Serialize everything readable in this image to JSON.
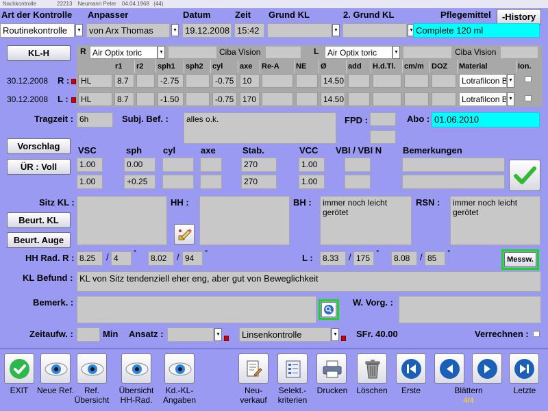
{
  "titlebar": {
    "app": "Nachkontrolle",
    "number": "22213",
    "customer": "Neumann Peter",
    "birthdate": "04.04.1968",
    "age": "(44)"
  },
  "header": {
    "art_label": "Art der Kontrolle",
    "anpasser_label": "Anpasser",
    "datum_label": "Datum",
    "zeit_label": "Zeit",
    "grundkl_label": "Grund KL",
    "grundkl2_label": "2. Grund KL",
    "pflege_label": "Pflegemittel",
    "history_button": "-History",
    "art_value": "Routinekontrolle",
    "anpasser_value": "von Arx  Thomas",
    "datum_value": "19.12.2008",
    "zeit_value": "15:42",
    "grundkl_value": "",
    "grundkl2_value": "",
    "pflege_value": "Complete 120 ml"
  },
  "lens": {
    "klh_button": "KL-H",
    "right_eye_label": "R",
    "right_product": "Air Optix toric",
    "right_maker": "Ciba Vision",
    "left_eye_label": "L",
    "left_product": "Air Optix toric",
    "left_maker": "Ciba Vision",
    "columns": [
      "r1",
      "r2",
      "sph1",
      "sph2",
      "cyl",
      "axe",
      "Re-A",
      "NE",
      "Ø",
      "add",
      "H.d.Tl.",
      "cm/m",
      "DOZ",
      "Material",
      "Ion."
    ],
    "rows": [
      {
        "date": "30.12.2008",
        "side": "R :",
        "type": "HL",
        "r1": "8.7",
        "r2": "",
        "sph1": "-2.75",
        "sph2": "",
        "cyl": "-0.75",
        "axe": "10",
        "rea": "",
        "ne": "",
        "dia": "14.50",
        "add": "",
        "hdtl": "",
        "cmm": "",
        "doz": "",
        "material": "Lotrafilcon B"
      },
      {
        "date": "30.12.2008",
        "side": "L :",
        "type": "HL",
        "r1": "8.7",
        "r2": "",
        "sph1": "-1.50",
        "sph2": "",
        "cyl": "-0.75",
        "axe": "170",
        "rea": "",
        "ne": "",
        "dia": "14.50",
        "add": "",
        "hdtl": "",
        "cmm": "",
        "doz": "",
        "material": "Lotrafilcon B"
      }
    ]
  },
  "wear": {
    "tragzeit_label": "Tragzeit :",
    "tragzeit_value": "6h",
    "subj_label": "Subj. Bef. :",
    "subj_value": "alles o.k.",
    "fpd_label": "FPD :",
    "abo_label": "Abo :",
    "abo_value": "01.06.2010"
  },
  "visus": {
    "vorschlag_button": "Vorschlag",
    "ur_button": "ÜR : Voll",
    "headers": {
      "vsc": "VSC",
      "sph": "sph",
      "cyl": "cyl",
      "axe": "axe",
      "stab": "Stab.",
      "vcc": "VCC",
      "vbi": "VBI / VBI N",
      "bem": "Bemerkungen"
    },
    "rows": [
      {
        "vsc": "1.00",
        "sph": "0.00",
        "stab": "270",
        "vcc": "1.00"
      },
      {
        "vsc": "1.00",
        "sph": "+0.25",
        "stab": "270",
        "vcc": "1.00"
      }
    ]
  },
  "sitz": {
    "sitz_label": "Sitz KL :",
    "hh_label": "HH :",
    "bh_label": "BH :",
    "rsn_label": "RSN :",
    "bh_value": "immer noch leicht gerötet",
    "rsn_value": "immer noch leicht gerötet",
    "beurt_kl_button": "Beurt. KL",
    "beurt_auge_button": "Beurt. Auge"
  },
  "hhrad": {
    "label": "HH Rad. R :",
    "r1": "8.25",
    "r1b": "4",
    "r2": "8.02",
    "r2b": "94",
    "l_label": "L :",
    "l1": "8.33",
    "l1b": "175",
    "l2": "8.08",
    "l2b": "85",
    "degree": "°",
    "slash": "/",
    "messw_button": "Messw."
  },
  "befund": {
    "label": "KL Befund :",
    "value": "KL von Sitz tendenziell eher eng, aber gut von Beweglichkeit"
  },
  "bemerk": {
    "label": "Bemerk. :",
    "wvorg_label": "W. Vorg. :"
  },
  "zeit": {
    "label": "Zeitaufw. :",
    "min_label": "Min",
    "ansatz_label": "Ansatz :",
    "linsen_value": "Linsenkontrolle",
    "sfr_label": "SFr. 40.00",
    "verrechnen_label": "Verrechnen :"
  },
  "toolbar": {
    "exit": "EXIT",
    "neue_ref": "Neue Ref.",
    "ref_uebersicht": "Ref. Übersicht",
    "uebersicht_hh": "Übersicht HH-Rad.",
    "kd_kl": "Kd.-KL- Angaben",
    "neuverkauf": "Neu- verkauf",
    "selekt": "Selekt.- kriterien",
    "drucken": "Drucken",
    "loeschen": "Löschen",
    "erste": "Erste",
    "blaettern": "Blättern",
    "page": "4/4",
    "letzte": "Letzte"
  },
  "colors": {
    "background": "#9a9af2",
    "cyan": "#00ffff",
    "green": "#18d818",
    "blue": "#1a5fb8",
    "red": "#d00000"
  }
}
